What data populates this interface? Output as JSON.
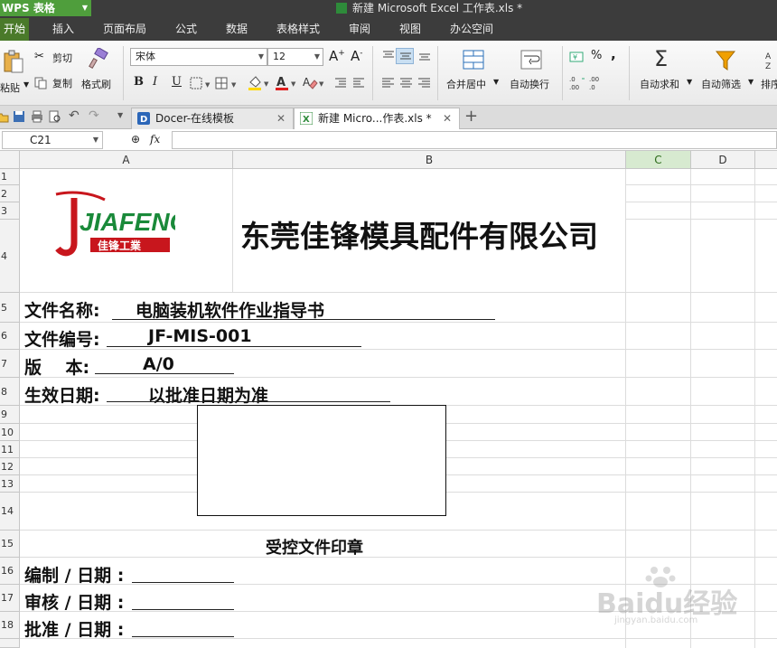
{
  "titlebar": {
    "app_label": "WPS 表格",
    "doc_title": "新建 Microsoft Excel 工作表.xls *"
  },
  "menu": [
    "开始",
    "插入",
    "页面布局",
    "公式",
    "数据",
    "表格样式",
    "审阅",
    "视图",
    "办公空间"
  ],
  "ribbon": {
    "paste": "粘贴",
    "cut": "剪切",
    "copy": "复制",
    "format_painter": "格式刷",
    "font_name": "宋体",
    "font_size": "12",
    "bold": "B",
    "italic": "I",
    "underline": "U",
    "merge_center": "合并居中",
    "wrap_text": "自动换行",
    "percent": "%",
    "comma": ",",
    "autosum": "自动求和",
    "autofilter": "自动筛选",
    "sort": "排序"
  },
  "doc_tabs": [
    {
      "label": "Docer-在线模板"
    },
    {
      "label": "新建 Micro...作表.xls *"
    }
  ],
  "formula_bar": {
    "cell_ref": "C21",
    "fx_label": "fx",
    "formula": ""
  },
  "columns": [
    "A",
    "B",
    "C",
    "D"
  ],
  "rows": [
    "1",
    "2",
    "3",
    "4",
    "5",
    "6",
    "7",
    "8",
    "9",
    "10",
    "11",
    "12",
    "13",
    "14",
    "15",
    "16",
    "17",
    "18"
  ],
  "sheet": {
    "logo_text": "JIAFENG",
    "logo_subtext": "佳锋工業",
    "company_name": "东莞佳锋模具配件有限公司",
    "doc_name_label": "文件名称:",
    "doc_name_value": "电脑装机软件作业指导书",
    "doc_no_label": "文件编号:",
    "doc_no_value": "JF-MIS-001",
    "version_label": "版    本:",
    "version_value": "A/0",
    "effective_label": "生效日期:",
    "effective_value": "以批准日期为准",
    "stamp_label": "受控文件印章",
    "prepared_label": "编制 / 日期 :",
    "reviewed_label": "审核 / 日期 :",
    "approved_label": "批准 / 日期 :"
  },
  "watermark": {
    "brand": "Baidu经验",
    "url": "jingyan.baidu.com"
  }
}
